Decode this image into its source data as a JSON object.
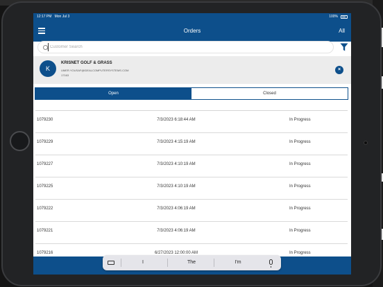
{
  "status_bar": {
    "time": "12:17 PM",
    "date": "Mon Jul 3",
    "battery": "100%"
  },
  "header": {
    "title": "Orders",
    "right_label": "All"
  },
  "search": {
    "placeholder": "Customer Search",
    "value": ""
  },
  "customer": {
    "initial": "K",
    "name": "KRISNET GOLF & GRASS",
    "email": "UMER.YOUSAF@IDEALCOMPUTERSYSTEMS.COM",
    "id": "17163"
  },
  "tabs": [
    {
      "label": "Open",
      "active": true
    },
    {
      "label": "Closed",
      "active": false
    }
  ],
  "orders": [
    {
      "id": "1079230",
      "date": "7/3/2023 6:18:44 AM",
      "status": "In Progress"
    },
    {
      "id": "1079229",
      "date": "7/3/2023 4:15:19 AM",
      "status": "In Progress"
    },
    {
      "id": "1079227",
      "date": "7/3/2023 4:10:19 AM",
      "status": "In Progress"
    },
    {
      "id": "1079225",
      "date": "7/3/2023 4:10:19 AM",
      "status": "In Progress"
    },
    {
      "id": "1079222",
      "date": "7/3/2023 4:06:19 AM",
      "status": "In Progress"
    },
    {
      "id": "1079221",
      "date": "7/3/2023 4:06:19 AM",
      "status": "In Progress"
    },
    {
      "id": "1079216",
      "date": "6/27/2023 12:00:00 AM",
      "status": "In Progress"
    }
  ],
  "keyboard": {
    "suggestions": [
      "I",
      "The",
      "I'm"
    ]
  },
  "colors": {
    "brand": "#0d4f8b",
    "card": "#ececec"
  },
  "icons": [
    "menu-icon",
    "search-icon",
    "filter-icon",
    "close-icon",
    "keyboard-icon",
    "microphone-icon"
  ]
}
